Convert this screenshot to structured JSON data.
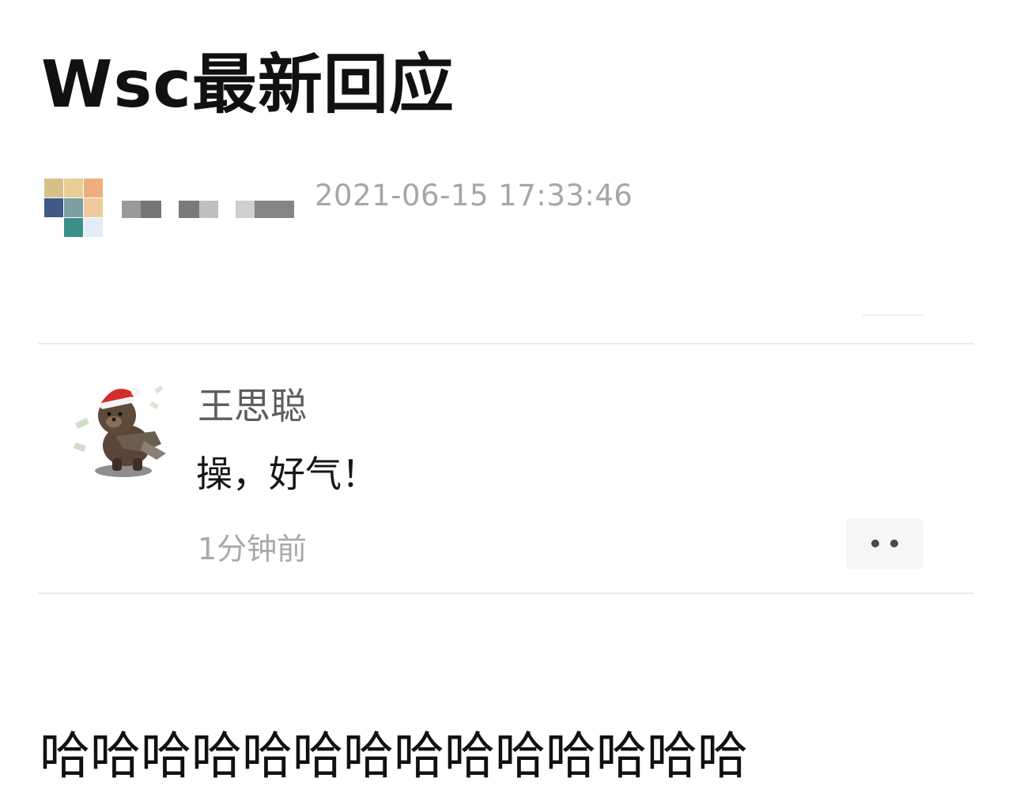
{
  "headline": "Wsc最新回应",
  "post": {
    "author_avatar_icon": "pixelated-avatar-icon",
    "author_name_redacted": true,
    "timestamp": "2021-06-15 17:33:46"
  },
  "comment": {
    "avatar_icon": "brown-bear-santa-hat-avatar-icon",
    "author": "王思聪",
    "text": "操，好气！",
    "time": "1分钟前",
    "more_icon": "more-dots-icon"
  },
  "caption": "哈哈哈哈哈哈哈哈哈哈哈哈哈哈",
  "colors": {
    "text_primary": "#111111",
    "text_secondary": "#5c5c5c",
    "timestamp_gray": "#a6a6a6",
    "divider": "#ebebeb",
    "more_button_bg": "#f6f6f6"
  }
}
